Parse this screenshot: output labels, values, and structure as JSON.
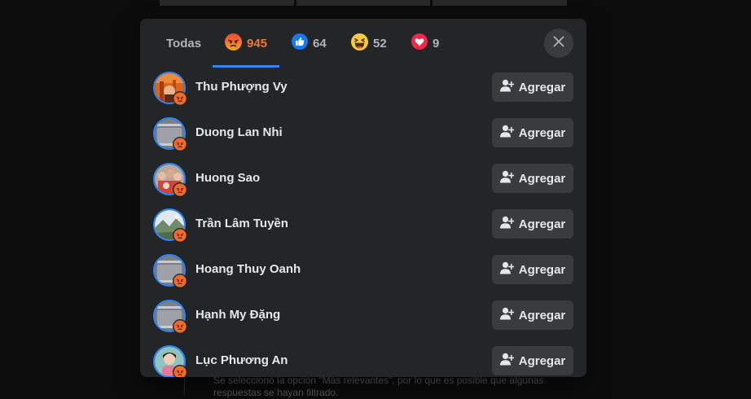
{
  "tabs": [
    {
      "label": "Todas",
      "count": "",
      "reaction": "all",
      "active": false
    },
    {
      "label": "",
      "count": "945",
      "reaction": "angry",
      "active": true
    },
    {
      "label": "",
      "count": "64",
      "reaction": "like",
      "active": false
    },
    {
      "label": "",
      "count": "52",
      "reaction": "haha",
      "active": false
    },
    {
      "label": "",
      "count": "9",
      "reaction": "love",
      "active": false
    }
  ],
  "close_icon": "close-icon",
  "add_button_label": "Agregar",
  "people": [
    {
      "name": "Thu Phượng Vy",
      "avatar": "orange-photo",
      "reaction": "angry"
    },
    {
      "name": "Duong Lan Nhi",
      "avatar": "default-silhouette",
      "reaction": "angry"
    },
    {
      "name": "Huong Sao",
      "avatar": "group-photo",
      "reaction": "angry"
    },
    {
      "name": "Trần Lâm Tuyền",
      "avatar": "landscape-photo",
      "reaction": "angry"
    },
    {
      "name": "Hoang Thuy Oanh",
      "avatar": "default-silhouette",
      "reaction": "angry"
    },
    {
      "name": "Hạnh My Đặng",
      "avatar": "default-silhouette",
      "reaction": "angry"
    },
    {
      "name": "Lục Phương An",
      "avatar": "portrait-photo",
      "reaction": "angry"
    }
  ],
  "background_caption": "Se seleccionó la opción \"Más relevantes\", por lo que es posible que algunas respuestas se hayan filtrado.",
  "colors": {
    "modal_bg": "#242527",
    "active_tab": "#e8793a",
    "accent_blue": "#2d88ff",
    "button_bg": "#3a3b3c",
    "text_primary": "#e4e6eb",
    "text_secondary": "#b0b3b8"
  }
}
